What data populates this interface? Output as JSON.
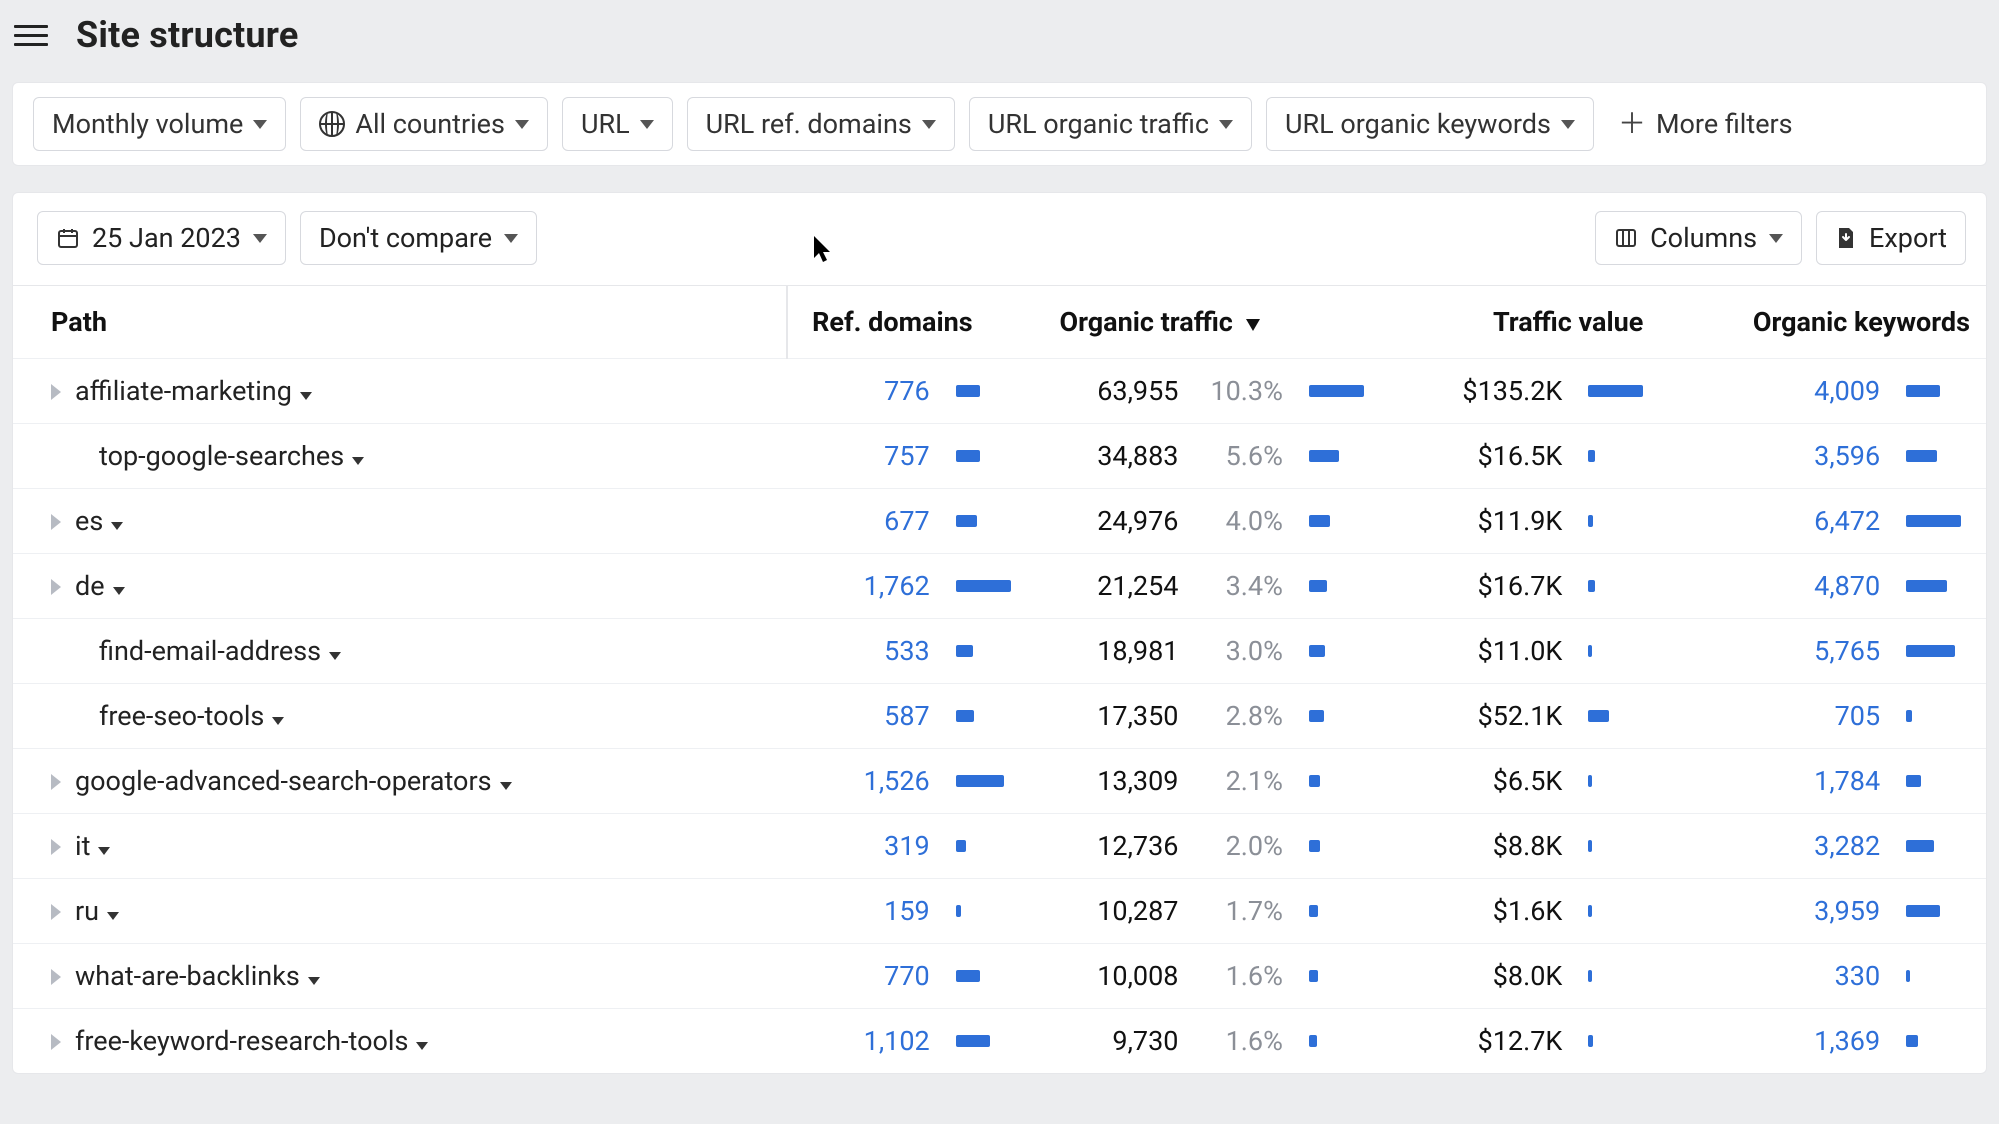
{
  "header": {
    "title": "Site structure"
  },
  "filters": {
    "volume_label": "Monthly volume",
    "countries_label": "All countries",
    "url_label": "URL",
    "url_ref_domains_label": "URL ref. domains",
    "url_organic_traffic_label": "URL organic traffic",
    "url_organic_keywords_label": "URL organic keywords",
    "more_filters_label": "More filters"
  },
  "toolbar": {
    "date_label": "25 Jan 2023",
    "compare_label": "Don't compare",
    "columns_label": "Columns",
    "export_label": "Export"
  },
  "columns": {
    "path": "Path",
    "ref_domains": "Ref. domains",
    "organic_traffic": "Organic traffic",
    "traffic_value": "Traffic value",
    "organic_keywords": "Organic keywords"
  },
  "sort": {
    "column": "organic_traffic",
    "dir": "desc"
  },
  "max": {
    "ref_domains": 1762,
    "organic_traffic": 63955,
    "traffic_value": 135200,
    "organic_keywords": 6472
  },
  "rows": [
    {
      "expandable": true,
      "indent": 0,
      "path": "affiliate-marketing",
      "ref_domains": "776",
      "ref_domains_n": 776,
      "organic_traffic": "63,955",
      "organic_traffic_n": 63955,
      "organic_traffic_pct": "10.3%",
      "traffic_value": "$135.2K",
      "traffic_value_n": 135200,
      "organic_keywords": "4,009",
      "organic_keywords_n": 4009
    },
    {
      "expandable": false,
      "indent": 1,
      "path": "top-google-searches",
      "ref_domains": "757",
      "ref_domains_n": 757,
      "organic_traffic": "34,883",
      "organic_traffic_n": 34883,
      "organic_traffic_pct": "5.6%",
      "traffic_value": "$16.5K",
      "traffic_value_n": 16500,
      "organic_keywords": "3,596",
      "organic_keywords_n": 3596
    },
    {
      "expandable": true,
      "indent": 0,
      "path": "es",
      "ref_domains": "677",
      "ref_domains_n": 677,
      "organic_traffic": "24,976",
      "organic_traffic_n": 24976,
      "organic_traffic_pct": "4.0%",
      "traffic_value": "$11.9K",
      "traffic_value_n": 11900,
      "organic_keywords": "6,472",
      "organic_keywords_n": 6472
    },
    {
      "expandable": true,
      "indent": 0,
      "path": "de",
      "ref_domains": "1,762",
      "ref_domains_n": 1762,
      "organic_traffic": "21,254",
      "organic_traffic_n": 21254,
      "organic_traffic_pct": "3.4%",
      "traffic_value": "$16.7K",
      "traffic_value_n": 16700,
      "organic_keywords": "4,870",
      "organic_keywords_n": 4870
    },
    {
      "expandable": false,
      "indent": 1,
      "path": "find-email-address",
      "ref_domains": "533",
      "ref_domains_n": 533,
      "organic_traffic": "18,981",
      "organic_traffic_n": 18981,
      "organic_traffic_pct": "3.0%",
      "traffic_value": "$11.0K",
      "traffic_value_n": 11000,
      "organic_keywords": "5,765",
      "organic_keywords_n": 5765
    },
    {
      "expandable": false,
      "indent": 1,
      "path": "free-seo-tools",
      "ref_domains": "587",
      "ref_domains_n": 587,
      "organic_traffic": "17,350",
      "organic_traffic_n": 17350,
      "organic_traffic_pct": "2.8%",
      "traffic_value": "$52.1K",
      "traffic_value_n": 52100,
      "organic_keywords": "705",
      "organic_keywords_n": 705
    },
    {
      "expandable": true,
      "indent": 0,
      "path": "google-advanced-search-operators",
      "ref_domains": "1,526",
      "ref_domains_n": 1526,
      "organic_traffic": "13,309",
      "organic_traffic_n": 13309,
      "organic_traffic_pct": "2.1%",
      "traffic_value": "$6.5K",
      "traffic_value_n": 6500,
      "organic_keywords": "1,784",
      "organic_keywords_n": 1784
    },
    {
      "expandable": true,
      "indent": 0,
      "path": "it",
      "ref_domains": "319",
      "ref_domains_n": 319,
      "organic_traffic": "12,736",
      "organic_traffic_n": 12736,
      "organic_traffic_pct": "2.0%",
      "traffic_value": "$8.8K",
      "traffic_value_n": 8800,
      "organic_keywords": "3,282",
      "organic_keywords_n": 3282
    },
    {
      "expandable": true,
      "indent": 0,
      "path": "ru",
      "ref_domains": "159",
      "ref_domains_n": 159,
      "organic_traffic": "10,287",
      "organic_traffic_n": 10287,
      "organic_traffic_pct": "1.7%",
      "traffic_value": "$1.6K",
      "traffic_value_n": 1600,
      "organic_keywords": "3,959",
      "organic_keywords_n": 3959
    },
    {
      "expandable": true,
      "indent": 0,
      "path": "what-are-backlinks",
      "ref_domains": "770",
      "ref_domains_n": 770,
      "organic_traffic": "10,008",
      "organic_traffic_n": 10008,
      "organic_traffic_pct": "1.6%",
      "traffic_value": "$8.0K",
      "traffic_value_n": 8000,
      "organic_keywords": "330",
      "organic_keywords_n": 330
    },
    {
      "expandable": true,
      "indent": 0,
      "path": "free-keyword-research-tools",
      "ref_domains": "1,102",
      "ref_domains_n": 1102,
      "organic_traffic": "9,730",
      "organic_traffic_n": 9730,
      "organic_traffic_pct": "1.6%",
      "traffic_value": "$12.7K",
      "traffic_value_n": 12700,
      "organic_keywords": "1,369",
      "organic_keywords_n": 1369
    }
  ]
}
